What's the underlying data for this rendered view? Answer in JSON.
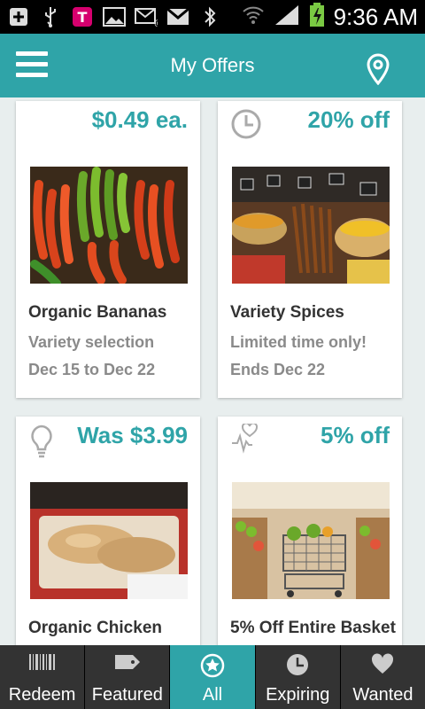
{
  "status_bar": {
    "time": "9:36 AM",
    "icons": [
      "add-icon",
      "usb-icon",
      "t-mobile-icon",
      "gallery-icon",
      "email-icon",
      "gmail-icon",
      "bluetooth-icon",
      "wifi-icon",
      "signal-icon",
      "battery-icon"
    ]
  },
  "app_bar": {
    "title": "My Offers",
    "menu_icon": "menu-icon",
    "location_icon": "location-pin-icon"
  },
  "offers": [
    {
      "headline": "$0.49 ea.",
      "icon": "",
      "name": "Organic Bananas",
      "line1": "Variety selection",
      "line2": "Dec 15 to Dec 22",
      "image": "bananas"
    },
    {
      "headline": "20% off",
      "icon": "clock-icon",
      "name": "Variety Spices",
      "line1": "Limited time only!",
      "line2": "Ends Dec 22",
      "image": "spices"
    },
    {
      "headline": "Was $3.99",
      "icon": "lightbulb-icon",
      "name": "Organic Chicken",
      "line1": "",
      "line2": "",
      "image": "chicken"
    },
    {
      "headline": "5% off",
      "icon": "heart-pulse-icon",
      "name": "5% Off Entire Basket",
      "line1": "",
      "line2": "",
      "image": "basket"
    }
  ],
  "tabs": [
    {
      "label": "Redeem",
      "icon": "barcode-icon",
      "active": false
    },
    {
      "label": "Featured",
      "icon": "tag-icon",
      "active": false
    },
    {
      "label": "All",
      "icon": "star-badge-icon",
      "active": true
    },
    {
      "label": "Expiring",
      "icon": "clock-icon",
      "active": false
    },
    {
      "label": "Wanted",
      "icon": "heart-icon",
      "active": false
    }
  ],
  "colors": {
    "accent": "#2fa4a8",
    "tabbar": "#333333",
    "text_dark": "#333333",
    "text_muted": "#8a8a8a"
  }
}
